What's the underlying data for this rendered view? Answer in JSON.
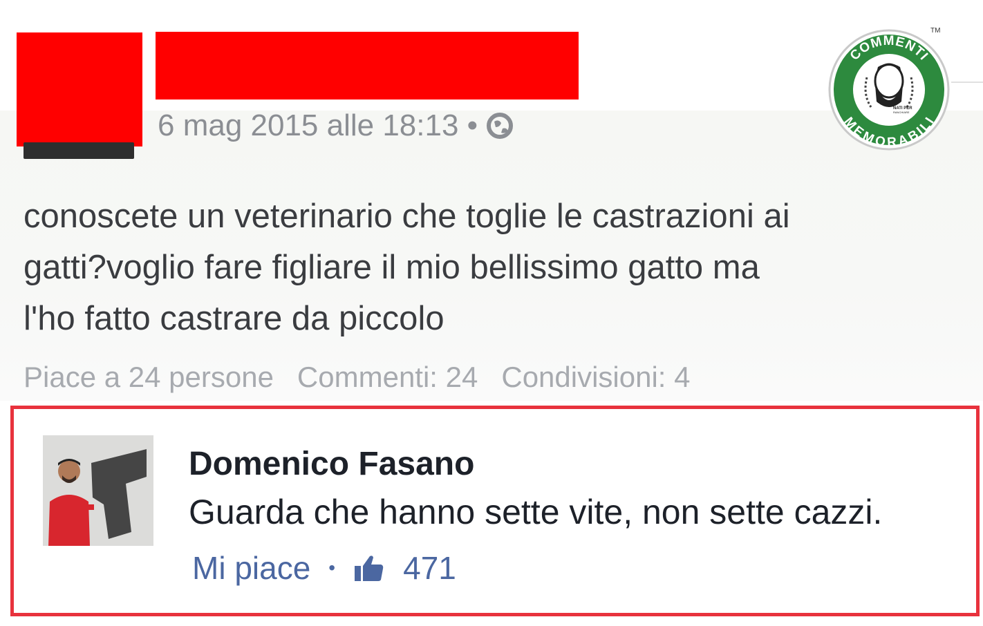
{
  "post": {
    "timestamp": "6 mag 2015 alle 18:13 •",
    "privacy_icon": "globe-icon",
    "text_lines": [
      "conoscete un veterinario che toglie le castrazioni ai",
      "gatti?voglio fare figliare il mio bellissimo gatto ma",
      "l'ho fatto castrare da piccolo"
    ],
    "stats": {
      "likes": "Piace a 24 persone",
      "comments": "Commenti: 24",
      "shares": "Condivisioni: 4"
    }
  },
  "logo": {
    "top_text": "COMMENTI",
    "bottom_text": "MEMORABILI",
    "tagline_1": "NATI PER",
    "tagline_2": "RANCHIARE",
    "trademark": "TM",
    "color": "#2d8a3e"
  },
  "comment": {
    "author": "Domenico Fasano",
    "text": "Guarda che hanno sette vite, non sette cazzi.",
    "like_label": "Mi piace",
    "separator": "•",
    "like_icon": "thumbs-up-icon",
    "like_count": "471",
    "highlight_color": "#e8323d",
    "link_color": "#4b67a1"
  }
}
